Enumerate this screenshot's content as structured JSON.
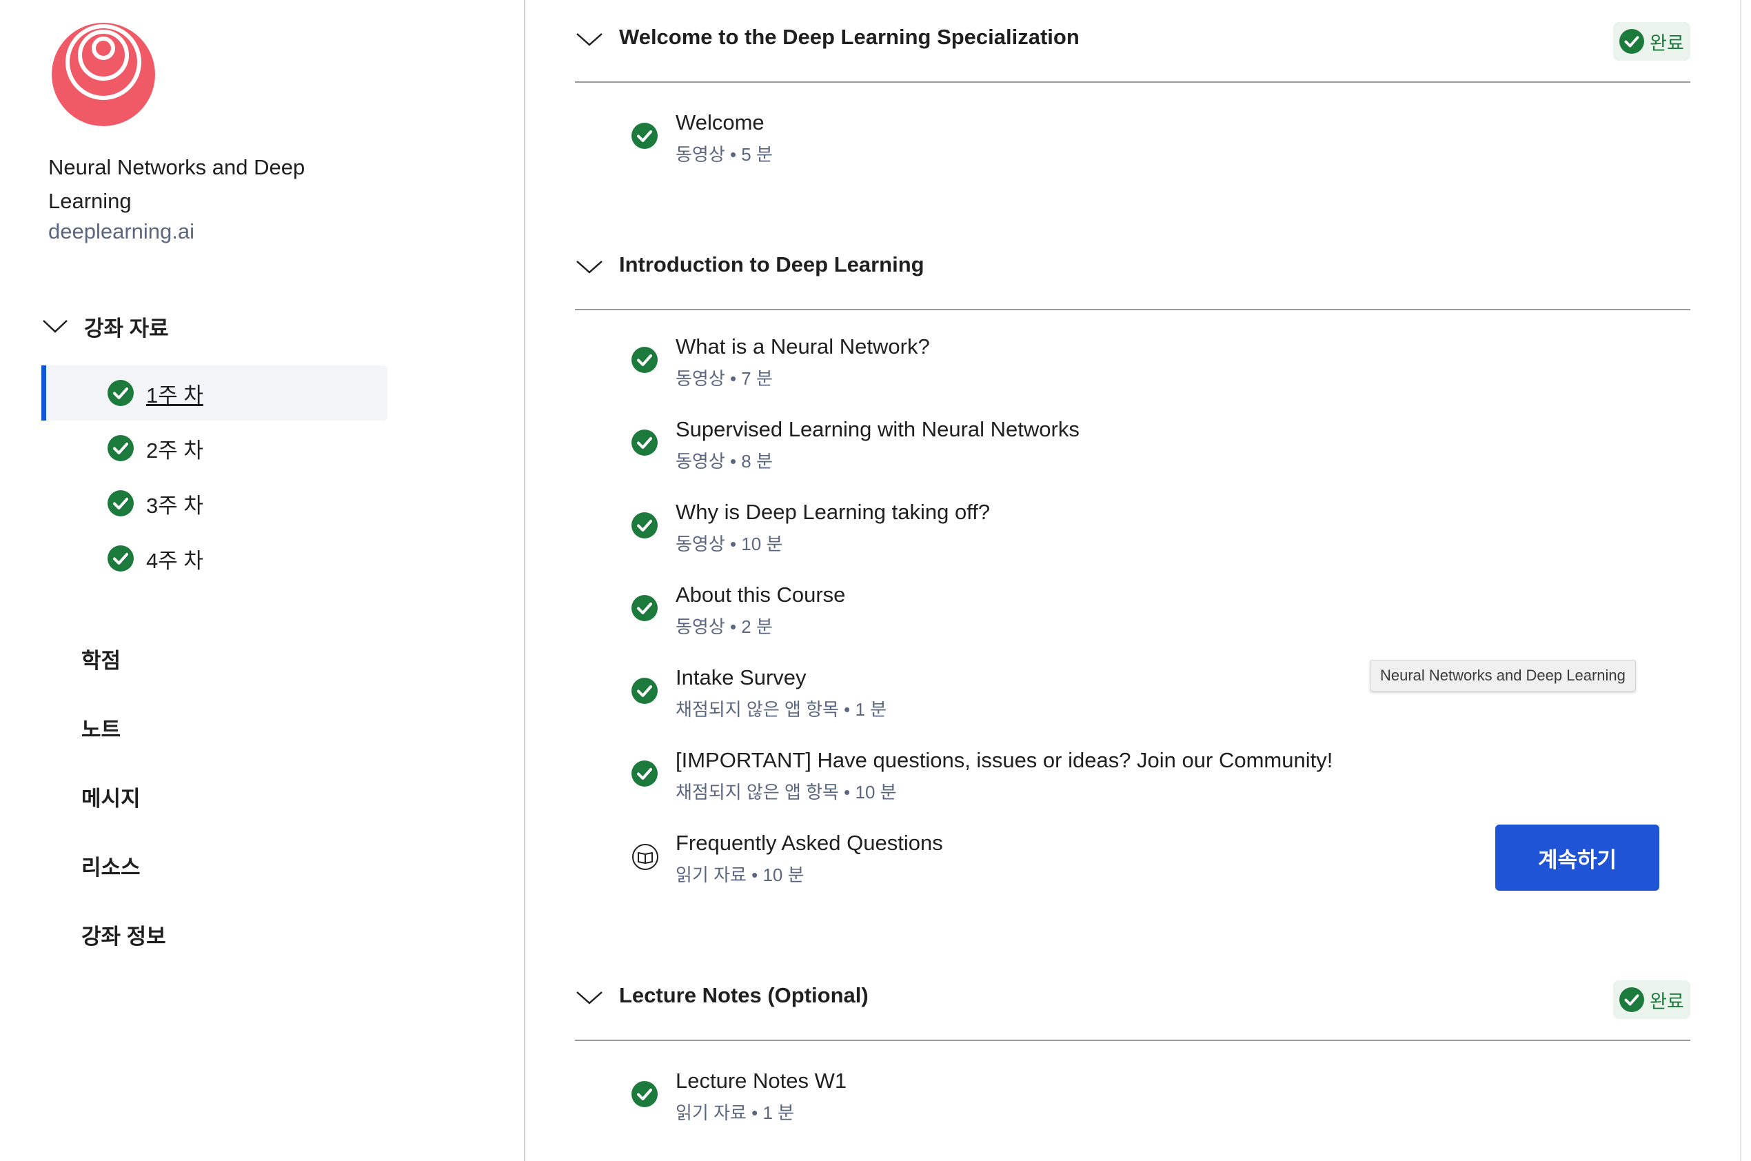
{
  "course": {
    "title": "Neural Networks and Deep Learning",
    "org": "deeplearning.ai"
  },
  "sidebar": {
    "section_label": "강좌 자료",
    "weeks": [
      {
        "label": "1주 차",
        "active": true
      },
      {
        "label": "2주 차"
      },
      {
        "label": "3주 차"
      },
      {
        "label": "4주 차"
      }
    ],
    "links": [
      "학점",
      "노트",
      "메시지",
      "리소스",
      "강좌 정보"
    ]
  },
  "modules": [
    {
      "title": "Welcome to the Deep Learning Specialization",
      "badge": "완료",
      "items": [
        {
          "name": "Welcome",
          "meta": "동영상 • 5 분",
          "icon": "check-circle-icon"
        }
      ]
    },
    {
      "title": "Introduction to Deep Learning",
      "items": [
        {
          "name": "What is a Neural Network?",
          "meta": "동영상 • 7 분",
          "icon": "check-circle-icon"
        },
        {
          "name": "Supervised Learning with Neural Networks",
          "meta": "동영상 • 8 분",
          "icon": "check-circle-icon"
        },
        {
          "name": "Why is Deep Learning taking off?",
          "meta": "동영상 • 10 분",
          "icon": "check-circle-icon"
        },
        {
          "name": "About this Course",
          "meta": "동영상 • 2 분",
          "icon": "check-circle-icon"
        },
        {
          "name": "Intake Survey",
          "meta": "채점되지 않은 앱 항목 • 1 분",
          "icon": "check-circle-icon"
        },
        {
          "name": "[IMPORTANT] Have questions, issues or ideas? Join our Community!",
          "meta": "채점되지 않은 앱 항목 • 10 분",
          "icon": "check-circle-icon"
        },
        {
          "name": "Frequently Asked Questions",
          "meta": "읽기 자료 • 10 분",
          "icon": "book-icon"
        }
      ]
    },
    {
      "title": "Lecture Notes (Optional)",
      "badge": "완료",
      "items": [
        {
          "name": "Lecture Notes W1",
          "meta": "읽기 자료 • 1 분",
          "icon": "check-circle-icon"
        }
      ]
    }
  ],
  "tooltip": "Neural Networks and Deep Learning",
  "continue_label": "계속하기",
  "colors": {
    "accent": "#1f54d6",
    "success": "#1d7a3d",
    "badge_bg": "#eaf3ec",
    "logo": "#f05a66"
  }
}
